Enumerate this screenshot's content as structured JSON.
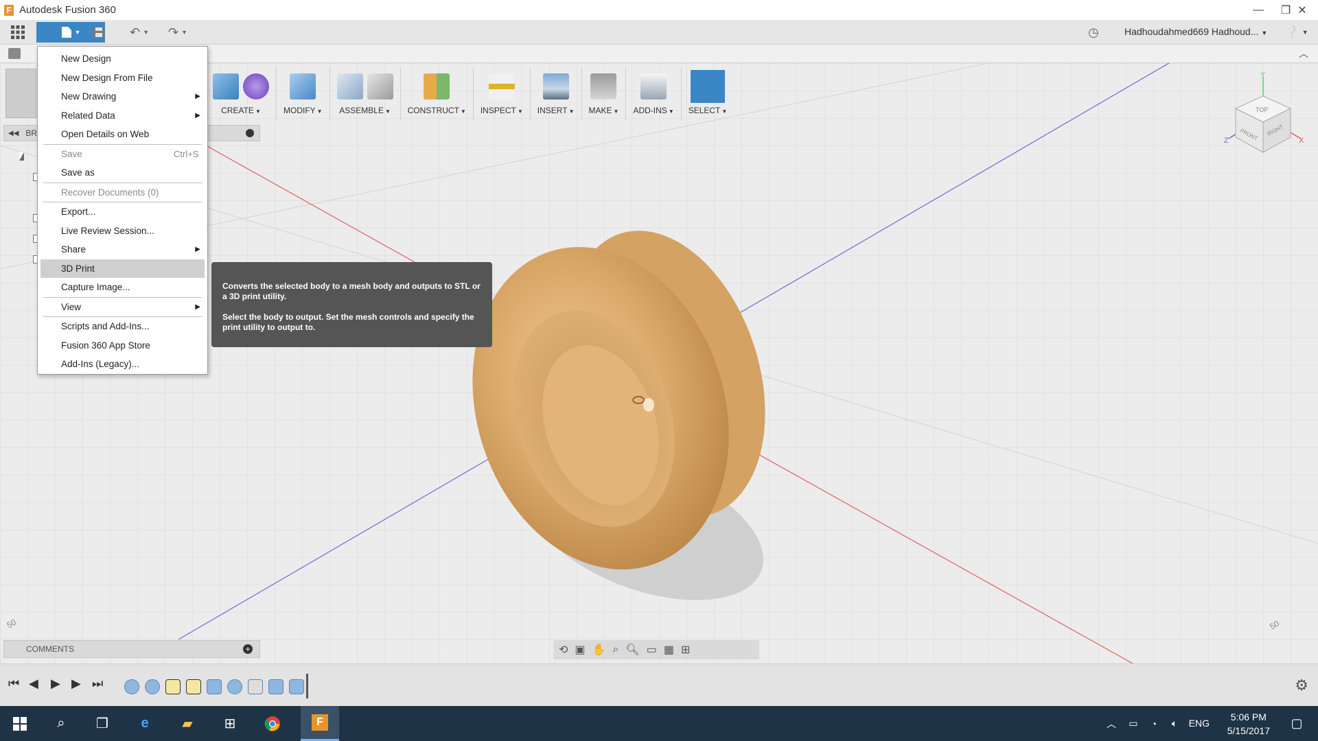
{
  "window": {
    "title": "Autodesk Fusion 360",
    "logo": "F"
  },
  "toolbar": {
    "user_name": "Hadhoudahmed669 Hadhoud..."
  },
  "ribbon": [
    {
      "label": "CREATE"
    },
    {
      "label": "MODIFY"
    },
    {
      "label": "ASSEMBLE"
    },
    {
      "label": "CONSTRUCT"
    },
    {
      "label": "INSPECT"
    },
    {
      "label": "INSERT"
    },
    {
      "label": "MAKE"
    },
    {
      "label": "ADD-INS"
    },
    {
      "label": "SELECT"
    }
  ],
  "browser": {
    "label": "BR"
  },
  "file_menu": {
    "items": [
      {
        "label": "New Design",
        "disabled": false
      },
      {
        "label": "New Design From File",
        "disabled": false
      },
      {
        "label": "New Drawing",
        "submenu": true
      },
      {
        "label": "Related Data",
        "submenu": true
      },
      {
        "label": "Open Details on Web"
      },
      {
        "label": "Save",
        "shortcut": "Ctrl+S",
        "disabled": true
      },
      {
        "label": "Save as"
      },
      {
        "label": "Recover Documents (0)",
        "disabled": true
      },
      {
        "label": "Export..."
      },
      {
        "label": "Live Review Session..."
      },
      {
        "label": "Share",
        "submenu": true
      },
      {
        "label": "3D Print",
        "highlighted": true
      },
      {
        "label": "Capture Image..."
      },
      {
        "label": "View",
        "submenu": true
      },
      {
        "label": "Scripts and Add-Ins..."
      },
      {
        "label": "Fusion 360 App Store"
      },
      {
        "label": "Add-Ins (Legacy)..."
      }
    ]
  },
  "tooltip": {
    "line1": "Converts the selected body to a mesh body and outputs to STL or a 3D print utility.",
    "line2": "Select the body to output. Set the mesh controls and specify the print utility to output to."
  },
  "comments": {
    "label": "COMMENTS"
  },
  "viewcube": {
    "top": "TOP",
    "front": "FRONT",
    "right": "RIGHT",
    "axis_x": "X",
    "axis_y": "Y",
    "axis_z": "Z"
  },
  "grid_labels": {
    "left": "50",
    "right": "50"
  },
  "taskbar": {
    "language": "ENG",
    "time": "5:06 PM",
    "date": "5/15/2017"
  },
  "colors": {
    "accent": "#3b86c5",
    "taskbar": "#1f3346",
    "wood": "#d9a868"
  }
}
